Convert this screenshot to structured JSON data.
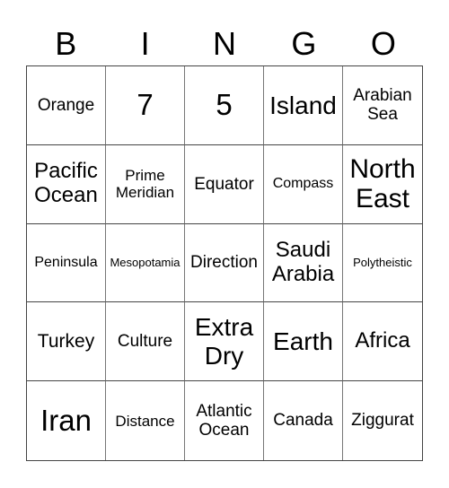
{
  "header": {
    "letters": [
      "B",
      "I",
      "N",
      "G",
      "O"
    ]
  },
  "cells": [
    "Orange",
    "7",
    "5",
    "Island",
    "Arabian Sea",
    "Pacific Ocean",
    "Prime Meridian",
    "Equator",
    "Compass",
    "North East",
    "Peninsula",
    "Mesopotamia",
    "Direction",
    "Saudi Arabia",
    "Polytheistic",
    "Turkey",
    "Culture",
    "Extra Dry",
    "Earth",
    "Africa",
    "Iran",
    "Distance",
    "Atlantic Ocean",
    "Canada",
    "Ziggurat"
  ]
}
